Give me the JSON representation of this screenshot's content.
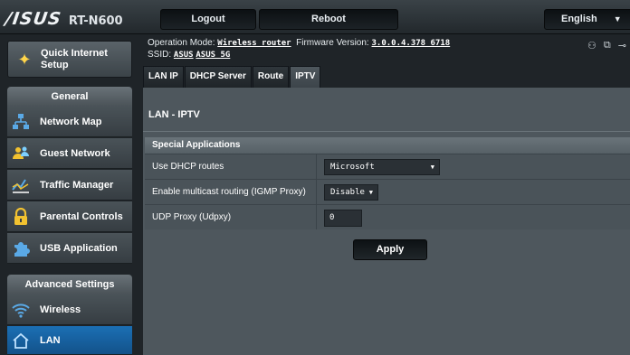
{
  "header": {
    "brand": "/ISUS",
    "model": "RT-N600",
    "logout_label": "Logout",
    "reboot_label": "Reboot",
    "language_label": "English"
  },
  "sidebar": {
    "quick_setup_label": "Quick Internet Setup",
    "general_header": "General",
    "general_items": [
      {
        "label": "Network Map",
        "icon": "network-map-icon"
      },
      {
        "label": "Guest Network",
        "icon": "guest-network-icon"
      },
      {
        "label": "Traffic Manager",
        "icon": "traffic-manager-icon"
      },
      {
        "label": "Parental Controls",
        "icon": "lock-icon"
      },
      {
        "label": "USB Application",
        "icon": "puzzle-icon"
      }
    ],
    "advanced_header": "Advanced Settings",
    "advanced_items": [
      {
        "label": "Wireless",
        "icon": "wifi-icon"
      },
      {
        "label": "LAN",
        "icon": "home-icon",
        "active": true
      }
    ]
  },
  "status": {
    "operation_mode_label": "Operation Mode:",
    "operation_mode_value": "Wireless router",
    "firmware_label": "Firmware Version:",
    "firmware_value": "3.0.0.4.378_6718",
    "ssid_label": "SSID:",
    "ssid_values": [
      "ASUS",
      "ASUS_5G"
    ]
  },
  "tabs": [
    {
      "label": "LAN IP",
      "active": false
    },
    {
      "label": "DHCP Server",
      "active": false
    },
    {
      "label": "Route",
      "active": false
    },
    {
      "label": "IPTV",
      "active": true
    }
  ],
  "panel": {
    "title": "LAN - IPTV",
    "section_header": "Special Applications",
    "rows": [
      {
        "label": "Use DHCP routes",
        "value": "Microsoft"
      },
      {
        "label": "Enable multicast routing (IGMP Proxy)",
        "value": "Disable"
      },
      {
        "label": "UDP Proxy (Udpxy)",
        "value": "0"
      }
    ],
    "apply_label": "Apply"
  },
  "colors": {
    "accent": "#1b6fb4",
    "background": "#1f2428",
    "panel": "#4e575d"
  }
}
